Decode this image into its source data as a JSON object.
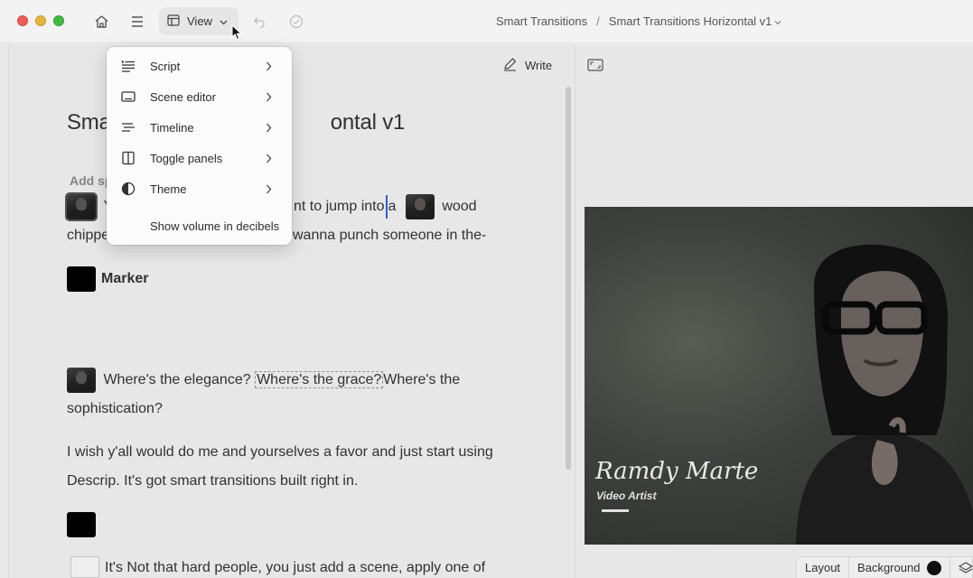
{
  "titlebar": {
    "view_label": "View",
    "breadcrumb": {
      "parent": "Smart Transitions",
      "separator": "/",
      "current": "Smart Transitions Horizontal v1"
    }
  },
  "script": {
    "write_label": "Write",
    "title_prefix": "Sma",
    "title_suffix": "ontal v1",
    "add_speaker": "Add sp",
    "line1_start": "Y",
    "line1_mid": "nt to jump into",
    "line1_a": "a",
    "line1_end": "wood",
    "line2_start": "chippe",
    "line2_end": "wanna punch someone in the-",
    "marker": "Marker",
    "line3_a": "Where's the elegance?",
    "line3_b": "Where's the grace?",
    "line3_c": "Where's the",
    "line4": "sophistication?",
    "line5": "I wish y'all would do me and yourselves a favor and just start using",
    "line6": "Descrip. It's got smart transitions built right in.",
    "line7": "It's Not that hard people, you just add a scene, apply one of"
  },
  "menu": {
    "items": [
      {
        "label": "Script",
        "icon": "script-icon"
      },
      {
        "label": "Scene editor",
        "icon": "scene-editor-icon"
      },
      {
        "label": "Timeline",
        "icon": "timeline-icon"
      },
      {
        "label": "Toggle panels",
        "icon": "toggle-panels-icon"
      },
      {
        "label": "Theme",
        "icon": "theme-icon"
      }
    ],
    "plain_item": "Show volume in decibels"
  },
  "preview": {
    "artist_name": "Ramdy Marte",
    "artist_role": "Video Artist"
  },
  "bottombar": {
    "layout_label": "Layout",
    "background_label": "Background",
    "background_color": "#111111"
  }
}
